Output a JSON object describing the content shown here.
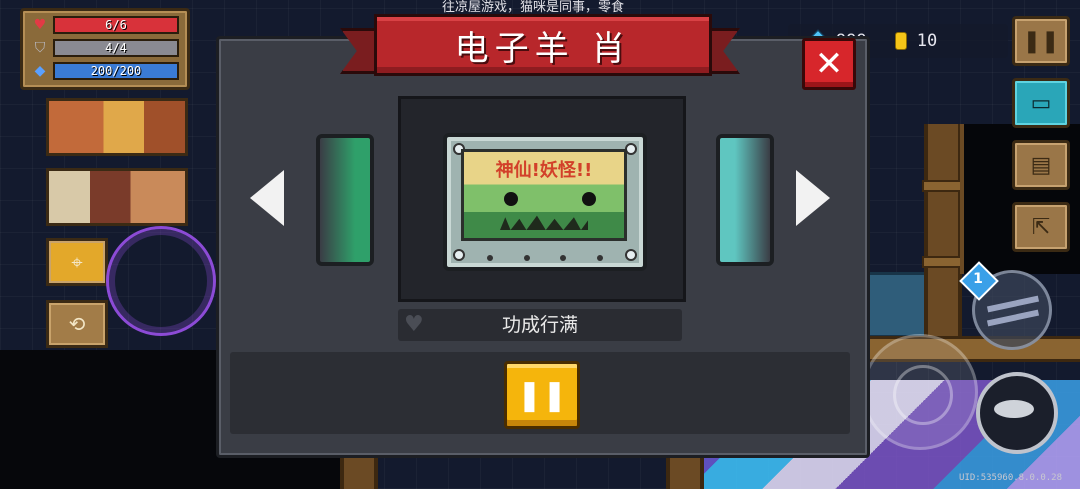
{
  "hud": {
    "health": "6/6",
    "armor": "4/4",
    "energy": "200/200",
    "health_fraction": 1.0,
    "armor_fraction": 1.0,
    "energy_fraction": 1.0,
    "gems": "999",
    "coins": "10",
    "top_hint": "往凉屋游戏，猫咪是同事，零食",
    "uid": "UID:535960.8.0.0.28",
    "ammo_count": "1"
  },
  "dialog": {
    "title": "电子羊 肖",
    "close_label": "✕",
    "item_name": "功成行满",
    "cart_label": "神仙!妖怪!!",
    "action_label": "❚❚",
    "prev_label": "previous",
    "next_label": "next"
  },
  "colors": {
    "banner_red": "#b8272b",
    "close_red": "#d7262b",
    "action_yellow": "#f5b50c",
    "dialog_bg": "#3a3d45",
    "health": "#d8323a",
    "armor": "#8a8a92",
    "energy": "#3a7bd5"
  },
  "icons": {
    "heart": "heart-icon",
    "shield": "shield-icon",
    "energy": "energy-diamond-icon",
    "gem": "gem-icon",
    "coin": "coin-icon",
    "pause": "pause-icon",
    "close": "close-icon",
    "favorite": "heart-outline-icon"
  }
}
